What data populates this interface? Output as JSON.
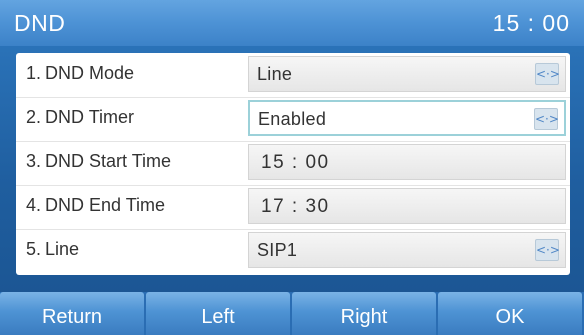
{
  "header": {
    "title": "DND",
    "clock": "15 : 00"
  },
  "settings": [
    {
      "num": "1.",
      "label": "DND Mode",
      "value": "Line",
      "has_arrows": true,
      "selected": false
    },
    {
      "num": "2.",
      "label": "DND Timer",
      "value": "Enabled",
      "has_arrows": true,
      "selected": true
    },
    {
      "num": "3.",
      "label": "DND Start Time",
      "value": "15 : 00",
      "has_arrows": false,
      "selected": false
    },
    {
      "num": "4.",
      "label": "DND End Time",
      "value": "17 : 30",
      "has_arrows": false,
      "selected": false
    },
    {
      "num": "5.",
      "label": "Line",
      "value": "SIP1",
      "has_arrows": true,
      "selected": false
    }
  ],
  "arrow_glyph": "<·>",
  "softkeys": {
    "return": "Return",
    "left": "Left",
    "right": "Right",
    "ok": "OK"
  },
  "colors": {
    "title_bar": "#4d92d5",
    "background": "#1f5e9f",
    "selected_border": "#9cd1d9",
    "arrow_accent": "#4f86c6"
  }
}
